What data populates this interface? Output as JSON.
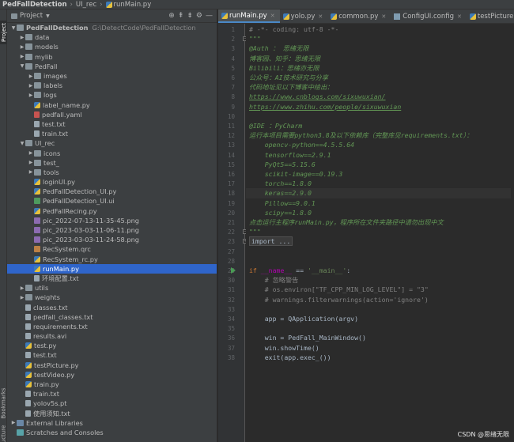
{
  "breadcrumb": {
    "project": "PedFallDetection",
    "folder": "UI_rec",
    "file": "runMain.py"
  },
  "stripe": {
    "project_label": "Project",
    "bookmarks_label": "Bookmarks",
    "structure_label": "Structure"
  },
  "panel": {
    "title": "Project",
    "tool_icons": [
      "target-icon",
      "collapse-all-icon",
      "expand-all-icon",
      "gear-icon",
      "hide-icon"
    ]
  },
  "tree": [
    {
      "indent": 0,
      "arrow": "down",
      "icon": "folder",
      "label": "PedFallDetection",
      "bold": true,
      "path": "G:\\DetectCode\\PedFallDetection"
    },
    {
      "indent": 1,
      "arrow": "right",
      "icon": "folder",
      "label": "data"
    },
    {
      "indent": 1,
      "arrow": "right",
      "icon": "folder",
      "label": "models"
    },
    {
      "indent": 1,
      "arrow": "right",
      "icon": "folder",
      "label": "mylib"
    },
    {
      "indent": 1,
      "arrow": "down",
      "icon": "folder",
      "label": "PedFall"
    },
    {
      "indent": 2,
      "arrow": "right",
      "icon": "folder",
      "label": "images"
    },
    {
      "indent": 2,
      "arrow": "right",
      "icon": "folder",
      "label": "labels"
    },
    {
      "indent": 2,
      "arrow": "right",
      "icon": "folder",
      "label": "logs"
    },
    {
      "indent": 2,
      "arrow": "",
      "icon": "py",
      "label": "label_name.py"
    },
    {
      "indent": 2,
      "arrow": "",
      "icon": "yaml",
      "label": "pedfall.yaml"
    },
    {
      "indent": 2,
      "arrow": "",
      "icon": "txt",
      "label": "test.txt"
    },
    {
      "indent": 2,
      "arrow": "",
      "icon": "txt",
      "label": "train.txt"
    },
    {
      "indent": 1,
      "arrow": "down",
      "icon": "folder",
      "label": "UI_rec"
    },
    {
      "indent": 2,
      "arrow": "right",
      "icon": "folder",
      "label": "icons"
    },
    {
      "indent": 2,
      "arrow": "right",
      "icon": "folder",
      "label": "test_"
    },
    {
      "indent": 2,
      "arrow": "right",
      "icon": "folder",
      "label": "tools"
    },
    {
      "indent": 2,
      "arrow": "",
      "icon": "py",
      "label": "loginUI.py"
    },
    {
      "indent": 2,
      "arrow": "",
      "icon": "py",
      "label": "PedFallDetection_UI.py"
    },
    {
      "indent": 2,
      "arrow": "",
      "icon": "ui",
      "label": "PedFallDetection_UI.ui"
    },
    {
      "indent": 2,
      "arrow": "",
      "icon": "py",
      "label": "PedFallRecing.py"
    },
    {
      "indent": 2,
      "arrow": "",
      "icon": "png",
      "label": "pic_2022-07-13-11-35-45.png"
    },
    {
      "indent": 2,
      "arrow": "",
      "icon": "png",
      "label": "pic_2023-03-03-11-06-11.png"
    },
    {
      "indent": 2,
      "arrow": "",
      "icon": "png",
      "label": "pic_2023-03-03-11-24-58.png"
    },
    {
      "indent": 2,
      "arrow": "",
      "icon": "qrc",
      "label": "RecSystem.qrc"
    },
    {
      "indent": 2,
      "arrow": "",
      "icon": "py",
      "label": "RecSystem_rc.py"
    },
    {
      "indent": 2,
      "arrow": "",
      "icon": "py",
      "label": "runMain.py",
      "selected": true
    },
    {
      "indent": 2,
      "arrow": "",
      "icon": "txt",
      "label": "环境配置.txt"
    },
    {
      "indent": 1,
      "arrow": "right",
      "icon": "folder",
      "label": "utils"
    },
    {
      "indent": 1,
      "arrow": "right",
      "icon": "folder",
      "label": "weights"
    },
    {
      "indent": 1,
      "arrow": "",
      "icon": "txt",
      "label": "classes.txt"
    },
    {
      "indent": 1,
      "arrow": "",
      "icon": "txt",
      "label": "pedfall_classes.txt"
    },
    {
      "indent": 1,
      "arrow": "",
      "icon": "txt",
      "label": "requirements.txt"
    },
    {
      "indent": 1,
      "arrow": "",
      "icon": "txt",
      "label": "results.avi"
    },
    {
      "indent": 1,
      "arrow": "",
      "icon": "py",
      "label": "test.py"
    },
    {
      "indent": 1,
      "arrow": "",
      "icon": "txt",
      "label": "test.txt"
    },
    {
      "indent": 1,
      "arrow": "",
      "icon": "py",
      "label": "testPicture.py"
    },
    {
      "indent": 1,
      "arrow": "",
      "icon": "py",
      "label": "testVideo.py"
    },
    {
      "indent": 1,
      "arrow": "",
      "icon": "py",
      "label": "train.py"
    },
    {
      "indent": 1,
      "arrow": "",
      "icon": "txt",
      "label": "train.txt"
    },
    {
      "indent": 1,
      "arrow": "",
      "icon": "txt",
      "label": "yolov5s.pt"
    },
    {
      "indent": 1,
      "arrow": "",
      "icon": "txt",
      "label": "使用须知.txt"
    },
    {
      "indent": 0,
      "arrow": "right",
      "icon": "lib",
      "label": "External Libraries"
    },
    {
      "indent": 0,
      "arrow": "",
      "icon": "scr",
      "label": "Scratches and Consoles"
    }
  ],
  "tabs": [
    {
      "label": "runMain.py",
      "icon": "py",
      "active": true
    },
    {
      "label": "yolo.py",
      "icon": "py"
    },
    {
      "label": "common.py",
      "icon": "py"
    },
    {
      "label": "ConfigUI.config",
      "icon": "config"
    },
    {
      "label": "testPicture.py",
      "icon": "py"
    }
  ],
  "editor": {
    "current_line": 18,
    "run_marker_line": 29,
    "lines": [
      {
        "n": 1,
        "parts": [
          [
            "com",
            "# -*- coding: utf-8 -*-"
          ]
        ]
      },
      {
        "n": 2,
        "parts": [
          [
            "doc",
            "\"\"\""
          ]
        ]
      },
      {
        "n": 3,
        "parts": [
          [
            "doc",
            "@Auth ： 思绪无限"
          ]
        ]
      },
      {
        "n": 4,
        "parts": [
          [
            "doc",
            "博客园、知乎：思绪无限"
          ]
        ]
      },
      {
        "n": 5,
        "parts": [
          [
            "doc",
            "Bilibili：思绪亦无限"
          ]
        ]
      },
      {
        "n": 6,
        "parts": [
          [
            "doc",
            "公众号：AI技术研究与分享"
          ]
        ]
      },
      {
        "n": 7,
        "parts": [
          [
            "doc",
            "代码地址见以下博客中给出："
          ]
        ]
      },
      {
        "n": 8,
        "parts": [
          [
            "link",
            "https://www.cnblogs.com/sixuwuxian/"
          ]
        ]
      },
      {
        "n": 9,
        "parts": [
          [
            "link",
            "https://www.zhihu.com/people/sixuwuxian"
          ]
        ]
      },
      {
        "n": 10,
        "parts": []
      },
      {
        "n": 11,
        "parts": [
          [
            "doc",
            "@IDE ：PyCharm"
          ]
        ]
      },
      {
        "n": 12,
        "parts": [
          [
            "doc",
            "运行本项目需要python3.8及以下依赖库（完整库见requirements.txt）："
          ]
        ]
      },
      {
        "n": 13,
        "parts": [
          [
            "doc",
            "    opencv-python==4.5.5.64"
          ]
        ]
      },
      {
        "n": 14,
        "parts": [
          [
            "doc",
            "    tensorflow==2.9.1"
          ]
        ]
      },
      {
        "n": 15,
        "parts": [
          [
            "doc",
            "    PyQt5==5.15.6"
          ]
        ]
      },
      {
        "n": 16,
        "parts": [
          [
            "doc",
            "    scikit-image==0.19.3"
          ]
        ]
      },
      {
        "n": 17,
        "parts": [
          [
            "doc",
            "    torch==1.8.0"
          ]
        ]
      },
      {
        "n": 18,
        "parts": [
          [
            "doc",
            "    keras==2.9.0"
          ]
        ]
      },
      {
        "n": 19,
        "parts": [
          [
            "doc",
            "    Pillow==9.0.1"
          ]
        ]
      },
      {
        "n": 20,
        "parts": [
          [
            "doc",
            "    scipy==1.8.0"
          ]
        ]
      },
      {
        "n": 21,
        "parts": [
          [
            "doc",
            "点击运行主程序runMain.py，程序所在文件夹路径中请勿出现中文"
          ]
        ]
      },
      {
        "n": 22,
        "parts": [
          [
            "doc",
            "\"\"\""
          ]
        ]
      },
      {
        "n": 23,
        "parts": [
          [
            "folded",
            "import ..."
          ]
        ]
      },
      {
        "n": 27,
        "parts": []
      },
      {
        "n": 28,
        "parts": []
      },
      {
        "n": 29,
        "parts": [
          [
            "kw",
            "if "
          ],
          [
            "dun",
            "__name__"
          ],
          [
            "txt",
            " == "
          ],
          [
            "str",
            "'__main__'"
          ],
          [
            "txt",
            ":"
          ]
        ]
      },
      {
        "n": 30,
        "parts": [
          [
            "com",
            "    # 忽略警告"
          ]
        ]
      },
      {
        "n": 31,
        "parts": [
          [
            "com",
            "    # os.environ[\"TF_CPP_MIN_LOG_LEVEL\"] = \"3\""
          ]
        ]
      },
      {
        "n": 32,
        "parts": [
          [
            "com",
            "    # warnings.filterwarnings(action='ignore')"
          ]
        ]
      },
      {
        "n": 33,
        "parts": []
      },
      {
        "n": 34,
        "parts": [
          [
            "txt",
            "    app = QApplication(argv)"
          ]
        ]
      },
      {
        "n": 35,
        "parts": []
      },
      {
        "n": 36,
        "parts": [
          [
            "txt",
            "    win = PedFall_MainWindow()"
          ]
        ]
      },
      {
        "n": 37,
        "parts": [
          [
            "txt",
            "    win.showTime()"
          ]
        ]
      },
      {
        "n": 38,
        "parts": [
          [
            "txt",
            "    exit(app.exec_())"
          ]
        ]
      }
    ]
  },
  "watermark": "CSDN @思绪无限"
}
